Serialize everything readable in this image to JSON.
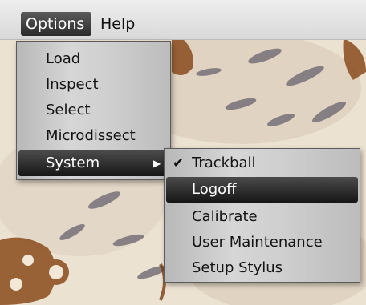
{
  "menubar": {
    "options_label": "Options",
    "help_label": "Help"
  },
  "options_menu": {
    "items": [
      {
        "label": "Load"
      },
      {
        "label": "Inspect"
      },
      {
        "label": "Select"
      },
      {
        "label": "Microdissect"
      },
      {
        "label": "System",
        "has_submenu": true,
        "highlighted": true
      }
    ]
  },
  "system_submenu": {
    "items": [
      {
        "label": "Trackball",
        "checked": true
      },
      {
        "label": "Logoff",
        "highlighted": true
      },
      {
        "label": "Calibrate"
      },
      {
        "label": "User Maintenance"
      },
      {
        "label": "Setup Stylus"
      }
    ]
  },
  "icons": {
    "check": "check-icon",
    "submenu_arrow": "chevron-right-icon"
  },
  "colors": {
    "highlight": "#1a1a1a",
    "menu_bg": "#cfcfcf"
  }
}
